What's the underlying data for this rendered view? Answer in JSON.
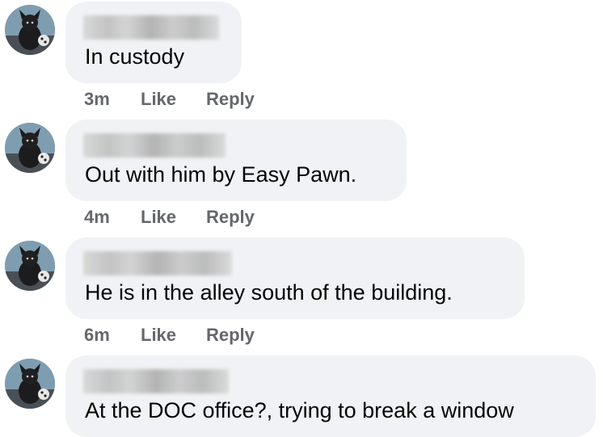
{
  "comments": [
    {
      "text": "In custody",
      "time": "3m",
      "like_label": "Like",
      "reply_label": "Reply"
    },
    {
      "text": "Out with him by Easy Pawn.",
      "time": "4m",
      "like_label": "Like",
      "reply_label": "Reply"
    },
    {
      "text": "He is in the alley south of the building.",
      "time": "6m",
      "like_label": "Like",
      "reply_label": "Reply"
    },
    {
      "text": "At the DOC office?, trying to break a window",
      "time": "",
      "like_label": "",
      "reply_label": ""
    }
  ],
  "colors": {
    "bubble_bg": "#f0f2f5",
    "text": "#050505",
    "meta": "#65676b"
  }
}
